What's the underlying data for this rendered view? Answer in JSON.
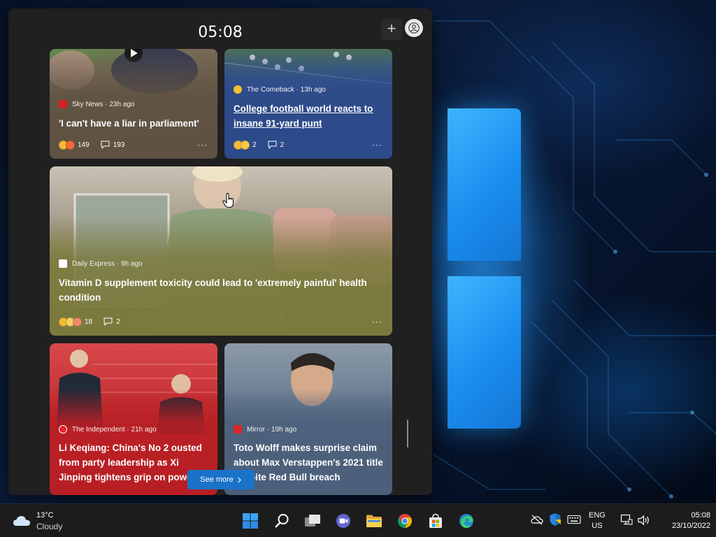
{
  "widgets": {
    "time": "05:08",
    "add_label": "+",
    "see_more_label": "See more",
    "cards": [
      {
        "id": "sky",
        "source": "Sky News",
        "age": "23h ago",
        "headline": "'I can't have a liar in parliament'",
        "reaction_count": "149",
        "comment_count": "193",
        "brand_color": "#d5231f",
        "background": "#6a5e4f"
      },
      {
        "id": "comeback",
        "source": "The Comeback",
        "age": "13h ago",
        "headline": "College football world reacts to insane 91-yard punt",
        "reaction_count": "2",
        "comment_count": "2",
        "brand_color": "#f2c12e",
        "background": "#2d4a8a"
      },
      {
        "id": "express",
        "source": "Daily Express",
        "age": "9h ago",
        "headline": "Vitamin D supplement toxicity could lead to 'extremely painful' health condition",
        "reaction_count": "18",
        "comment_count": "2",
        "brand_color": "#ffffff",
        "background": "#7b7a3e"
      },
      {
        "id": "independent",
        "source": "The Independent",
        "age": "21h ago",
        "headline": "Li Keqiang: China's No 2 ousted from party leadership as Xi Jinping tightens grip on power",
        "brand_color": "#e8212a",
        "background": "#b81f24"
      },
      {
        "id": "mirror",
        "source": "Mirror",
        "age": "19h ago",
        "headline": "Toto Wolff makes surprise claim about Max Verstappen's 2021 title despite Red Bull breach",
        "brand_color": "#d9262c",
        "background": "#4b5f7a"
      }
    ]
  },
  "taskbar": {
    "weather_temp": "13°C",
    "weather_condition": "Cloudy",
    "apps": [
      "start-icon",
      "search-icon",
      "task-view-icon",
      "teams-chat-icon",
      "file-explorer-icon",
      "chrome-icon",
      "microsoft-store-icon",
      "edge-icon"
    ],
    "tray_icons": [
      "onedrive-offline-icon",
      "defender-icon",
      "keyboard-icon",
      "network-icon",
      "volume-icon"
    ],
    "lang_primary": "ENG",
    "lang_secondary": "US",
    "time": "05:08",
    "date": "23/10/2022"
  },
  "accent_color": "#1a73c8"
}
